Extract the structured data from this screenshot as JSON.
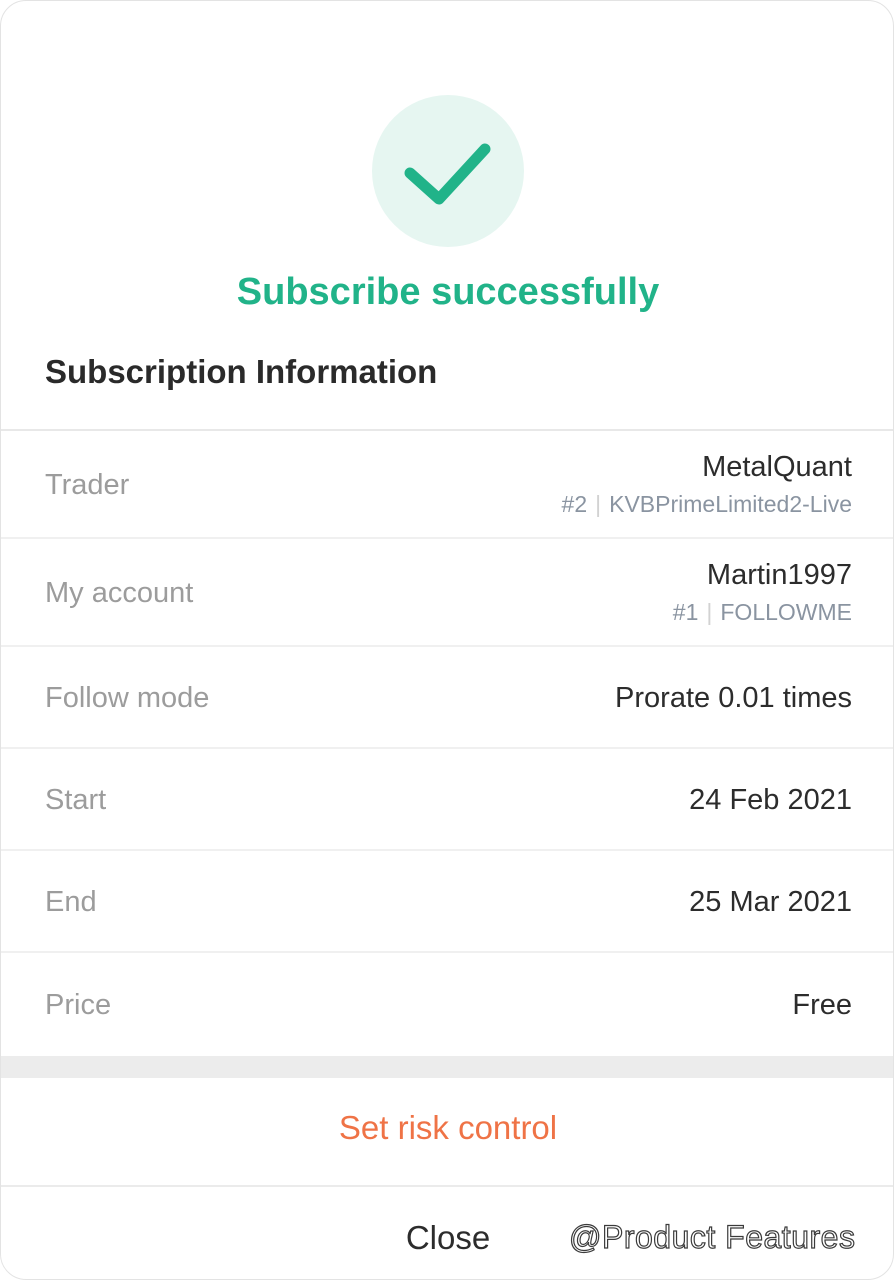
{
  "status": {
    "title": "Subscribe successfully",
    "icon": "checkmark-icon",
    "accent_color": "#21b389"
  },
  "section": {
    "title": "Subscription Information"
  },
  "rows": [
    {
      "label": "Trader",
      "value": "MetalQuant",
      "sub_index": "#2",
      "sub_name": "KVBPrimeLimited2-Live"
    },
    {
      "label": "My account",
      "value": "Martin1997",
      "sub_index": "#1",
      "sub_name": "FOLLOWME"
    },
    {
      "label": "Follow mode",
      "value": "Prorate 0.01 times"
    },
    {
      "label": "Start",
      "value": "24 Feb 2021"
    },
    {
      "label": "End",
      "value": "25 Mar 2021"
    },
    {
      "label": "Price",
      "value": "Free"
    }
  ],
  "actions": {
    "risk_control": "Set risk control",
    "risk_color": "#ef7346",
    "close": "Close"
  },
  "watermark": "@Product Features"
}
